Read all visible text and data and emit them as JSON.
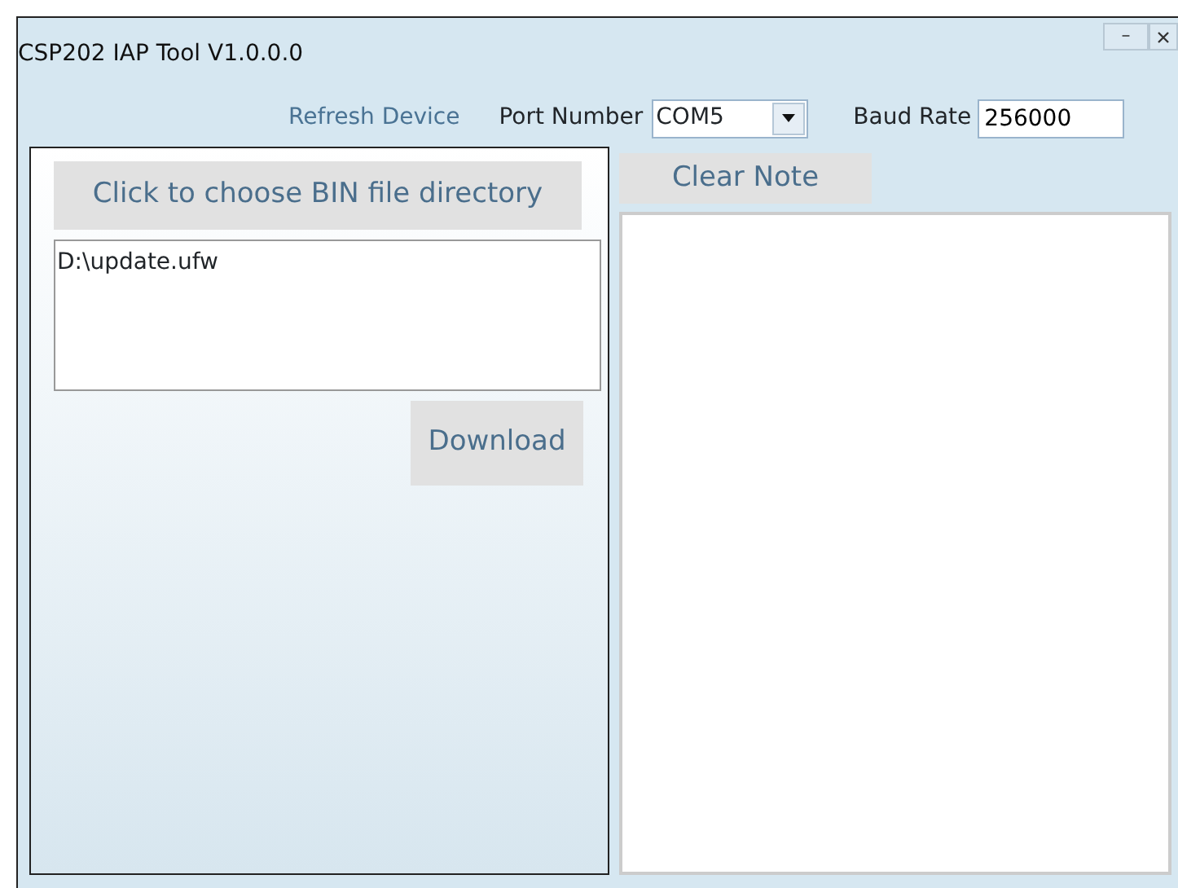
{
  "window": {
    "title": "CSP202 IAP Tool V1.0.0.0",
    "controls": [
      "–"
    ]
  },
  "toolbar": {
    "refresh_button": "Refresh Device",
    "port_label": "Port Number",
    "port_value": "COM5",
    "baud_label": "Baud Rate",
    "baud_value": "256000"
  },
  "left_panel": {
    "choose_button": "Click to choose BIN file directory",
    "path_text": "D:\\update.ufw",
    "download_button": "Download"
  },
  "right_panel": {
    "clear_button": "Clear Note"
  }
}
